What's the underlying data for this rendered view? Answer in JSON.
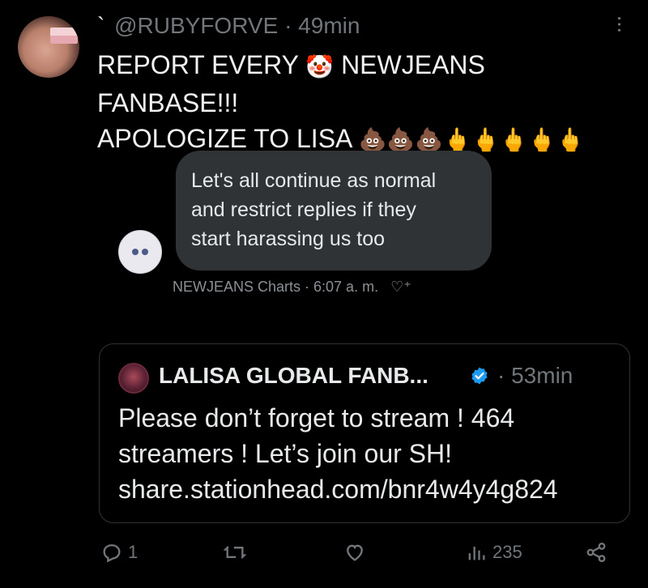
{
  "tweet": {
    "handle": "@RUBYFORVE",
    "separator": "·",
    "time": "49min",
    "line1_a": "REPORT EVERY",
    "line1_emoji": "🤡",
    "line1_b": "NEWJEANS FANBASE!!!",
    "line2": "APOLOGIZE TO LISA",
    "emojis": [
      "💩",
      "💩",
      "💩",
      "🖕",
      "🖕",
      "🖕",
      "🖕",
      "🖕"
    ]
  },
  "embedded_chat": {
    "message": "Let's all continue as normal\nand restrict replies if they\nstart harassing us too",
    "meta": "NEWJEANS Charts · 6:07 a. m."
  },
  "quote": {
    "name": "LALISA GLOBAL FANB...",
    "time": "· 53min",
    "text": "Please don’t forget to stream ! 464\nstreamers ! Let’s join our SH!\nshare.stationhead.com/bnr4w4y4g824"
  },
  "actions": {
    "reply_count": "1",
    "views_count": "235"
  },
  "icons": {
    "more": "more-vertical-icon",
    "reply": "reply-icon",
    "retweet": "retweet-icon",
    "like": "heart-icon",
    "views": "views-icon",
    "share": "share-icon",
    "verified": "verified-badge-icon"
  },
  "colors": {
    "background": "#000000",
    "text": "#e7e9ea",
    "muted": "#71767b",
    "bubble": "#2f3336",
    "verified": "#1d9bf0"
  }
}
